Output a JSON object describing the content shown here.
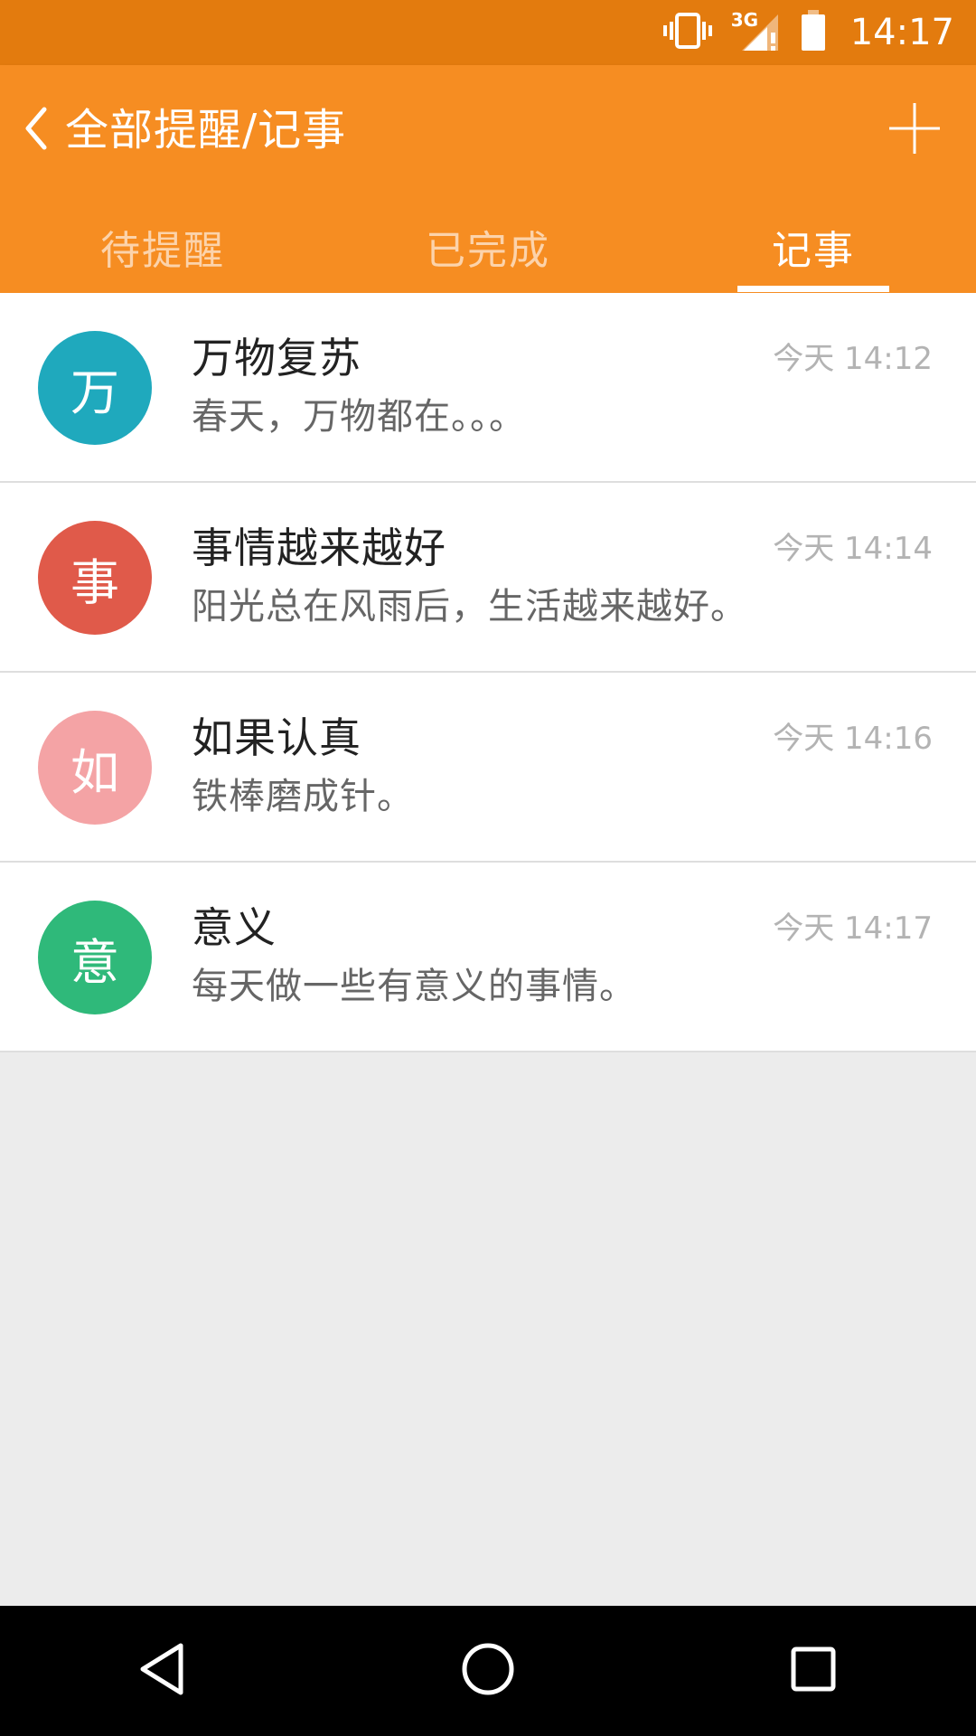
{
  "status_bar": {
    "time": "14:17",
    "network": "3G",
    "icons": [
      "vibrate-icon",
      "signal-3g-icon",
      "battery-icon"
    ]
  },
  "header": {
    "title": "全部提醒/记事",
    "back_icon": "chevron-left-icon",
    "add_icon": "plus-icon"
  },
  "tabs": [
    {
      "label": "待提醒",
      "active": false
    },
    {
      "label": "已完成",
      "active": false
    },
    {
      "label": "记事",
      "active": true
    }
  ],
  "notes": [
    {
      "avatar": "万",
      "avatar_color": "#1fa9bd",
      "title": "万物复苏",
      "body": "春天，万物都在。。。",
      "time": "今天 14:12"
    },
    {
      "avatar": "事",
      "avatar_color": "#e05a4a",
      "title": "事情越来越好",
      "body": "阳光总在风雨后，生活越来越好。",
      "time": "今天 14:14"
    },
    {
      "avatar": "如",
      "avatar_color": "#f4a3a5",
      "title": "如果认真",
      "body": "铁棒磨成针。",
      "time": "今天 14:16"
    },
    {
      "avatar": "意",
      "avatar_color": "#2fb97a",
      "title": "意义",
      "body": "每天做一些有意义的事情。",
      "time": "今天 14:17"
    }
  ],
  "colors": {
    "status_bar": "#e37b0e",
    "app_bar": "#f68d22",
    "background": "#ececec"
  },
  "nav_bar": {
    "icons": [
      "back-triangle-icon",
      "home-circle-icon",
      "recents-square-icon"
    ]
  }
}
